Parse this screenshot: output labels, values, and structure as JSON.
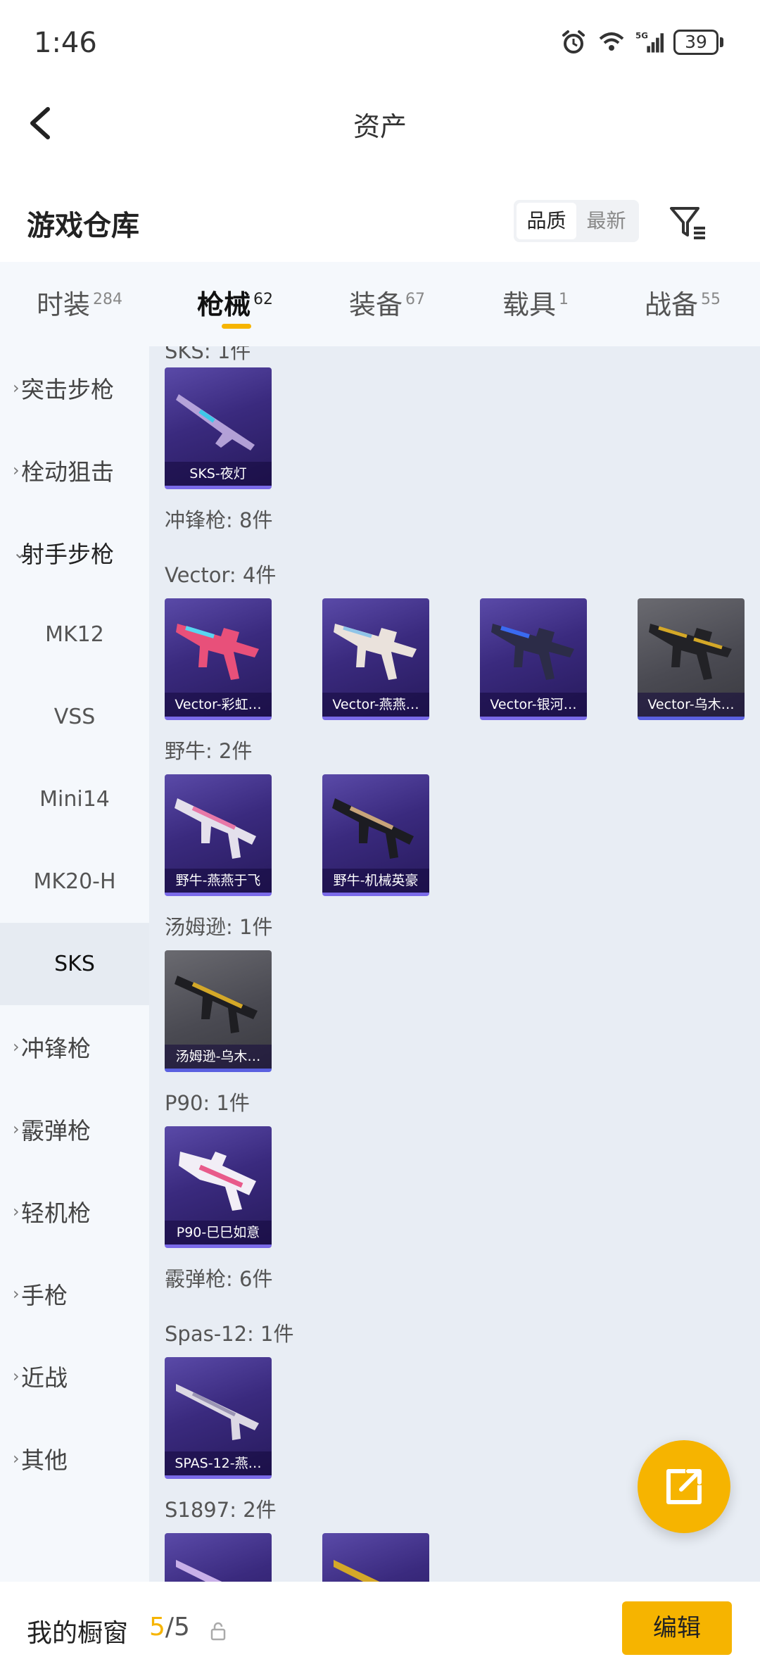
{
  "status_bar": {
    "time": "1:46",
    "battery": "39",
    "network": "5G"
  },
  "nav": {
    "title": "资产"
  },
  "header": {
    "section_title": "游戏仓库",
    "sort_options": [
      "品质",
      "最新"
    ],
    "active_sort": "品质"
  },
  "tabs": [
    {
      "label": "时装",
      "count": "284"
    },
    {
      "label": "枪械",
      "count": "62",
      "active": true
    },
    {
      "label": "装备",
      "count": "67"
    },
    {
      "label": "载具",
      "count": "1"
    },
    {
      "label": "战备",
      "count": "55"
    }
  ],
  "sidebar": {
    "items": [
      {
        "label": "突击步枪",
        "type": "category"
      },
      {
        "label": "栓动狙击",
        "type": "category"
      },
      {
        "label": "射手步枪",
        "type": "category",
        "expanded": true
      },
      {
        "label": "MK12",
        "type": "sub"
      },
      {
        "label": "VSS",
        "type": "sub"
      },
      {
        "label": "Mini14",
        "type": "sub"
      },
      {
        "label": "MK20-H",
        "type": "sub"
      },
      {
        "label": "SKS",
        "type": "sub",
        "selected": true
      },
      {
        "label": "冲锋枪",
        "type": "category"
      },
      {
        "label": "霰弹枪",
        "type": "category"
      },
      {
        "label": "轻机枪",
        "type": "category"
      },
      {
        "label": "手枪",
        "type": "category"
      },
      {
        "label": "近战",
        "type": "category"
      },
      {
        "label": "其他",
        "type": "category"
      }
    ]
  },
  "content": {
    "groups": [
      {
        "label": "SKS: 1件",
        "cards": [
          {
            "name": "SKS-夜灯",
            "rarity": "purple"
          }
        ]
      },
      {
        "label": "冲锋枪: 8件",
        "cards": []
      },
      {
        "label": "Vector: 4件",
        "cards": [
          {
            "name": "Vector-彩虹…",
            "rarity": "purple"
          },
          {
            "name": "Vector-燕燕…",
            "rarity": "purple"
          },
          {
            "name": "Vector-银河…",
            "rarity": "purple"
          },
          {
            "name": "Vector-乌木…",
            "rarity": "gray"
          }
        ]
      },
      {
        "label": "野牛: 2件",
        "cards": [
          {
            "name": "野牛-燕燕于飞",
            "rarity": "purple"
          },
          {
            "name": "野牛-机械英豪",
            "rarity": "purple"
          }
        ]
      },
      {
        "label": "汤姆逊: 1件",
        "cards": [
          {
            "name": "汤姆逊-乌木…",
            "rarity": "gray"
          }
        ]
      },
      {
        "label": "P90: 1件",
        "cards": [
          {
            "name": "P90-巳巳如意",
            "rarity": "purple"
          }
        ]
      },
      {
        "label": "霰弹枪: 6件",
        "cards": []
      },
      {
        "label": "Spas-12: 1件",
        "cards": [
          {
            "name": "SPAS-12-燕…",
            "rarity": "purple"
          }
        ]
      },
      {
        "label": "S1897: 2件",
        "cards": []
      }
    ]
  },
  "bottom_bar": {
    "showcase_label": "我的橱窗",
    "showcase_current": "5",
    "showcase_total": "/5",
    "edit_label": "编辑"
  },
  "colors": {
    "accent": "#f6b400",
    "content_bg": "#e8edf4",
    "sidebar_bg": "#f5f8fc"
  }
}
